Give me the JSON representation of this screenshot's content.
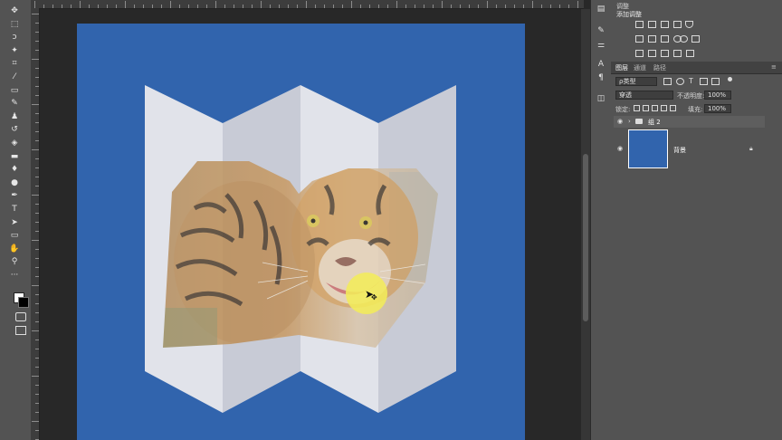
{
  "app": {
    "name": "Photoshop"
  },
  "colors": {
    "document_bg": "#3164ad",
    "panel_bg": "#535353",
    "canvas_bg": "#282828",
    "highlight": "#f3ec5a"
  },
  "tools": [
    {
      "name": "move-tool",
      "glyph": "✥"
    },
    {
      "name": "marquee-tool",
      "glyph": "⬚"
    },
    {
      "name": "lasso-tool",
      "glyph": "ↄ"
    },
    {
      "name": "magic-wand-tool",
      "glyph": "✦"
    },
    {
      "name": "crop-tool",
      "glyph": "⌗"
    },
    {
      "name": "eyedropper-tool",
      "glyph": "⁄"
    },
    {
      "name": "healing-tool",
      "glyph": "▭"
    },
    {
      "name": "brush-tool",
      "glyph": "✎"
    },
    {
      "name": "stamp-tool",
      "glyph": "♟"
    },
    {
      "name": "history-brush-tool",
      "glyph": "↺"
    },
    {
      "name": "eraser-tool",
      "glyph": "◈"
    },
    {
      "name": "gradient-tool",
      "glyph": "▬"
    },
    {
      "name": "blur-tool",
      "glyph": "♦"
    },
    {
      "name": "dodge-tool",
      "glyph": "●"
    },
    {
      "name": "pen-tool",
      "glyph": "✒"
    },
    {
      "name": "type-tool",
      "glyph": "T"
    },
    {
      "name": "path-select-tool",
      "glyph": "➤"
    },
    {
      "name": "shape-tool",
      "glyph": "▭"
    },
    {
      "name": "hand-tool",
      "glyph": "✋"
    },
    {
      "name": "zoom-tool",
      "glyph": "⚲"
    },
    {
      "name": "more-tools",
      "glyph": "···"
    }
  ],
  "adjustments": {
    "panel_title": "调整",
    "add_label": "添加调整"
  },
  "layers": {
    "tabs": [
      "图层",
      "通道",
      "路径"
    ],
    "filter_kind": "ρ类型",
    "blend_mode": "穿透",
    "opacity_label": "不透明度:",
    "opacity_value": "100%",
    "lock_label": "锁定:",
    "fill_label": "填充:",
    "fill_value": "100%",
    "items": [
      {
        "name": "组 2",
        "type": "group",
        "visible": true
      },
      {
        "name": "背景",
        "type": "background",
        "visible": true,
        "locked": true
      }
    ]
  },
  "illustration": {
    "subject": "tiger",
    "panels": [
      {
        "tone": "#e1e3ea"
      },
      {
        "tone": "#c8cbd6"
      },
      {
        "tone": "#e1e3ea"
      },
      {
        "tone": "#c8cbd6"
      }
    ]
  }
}
